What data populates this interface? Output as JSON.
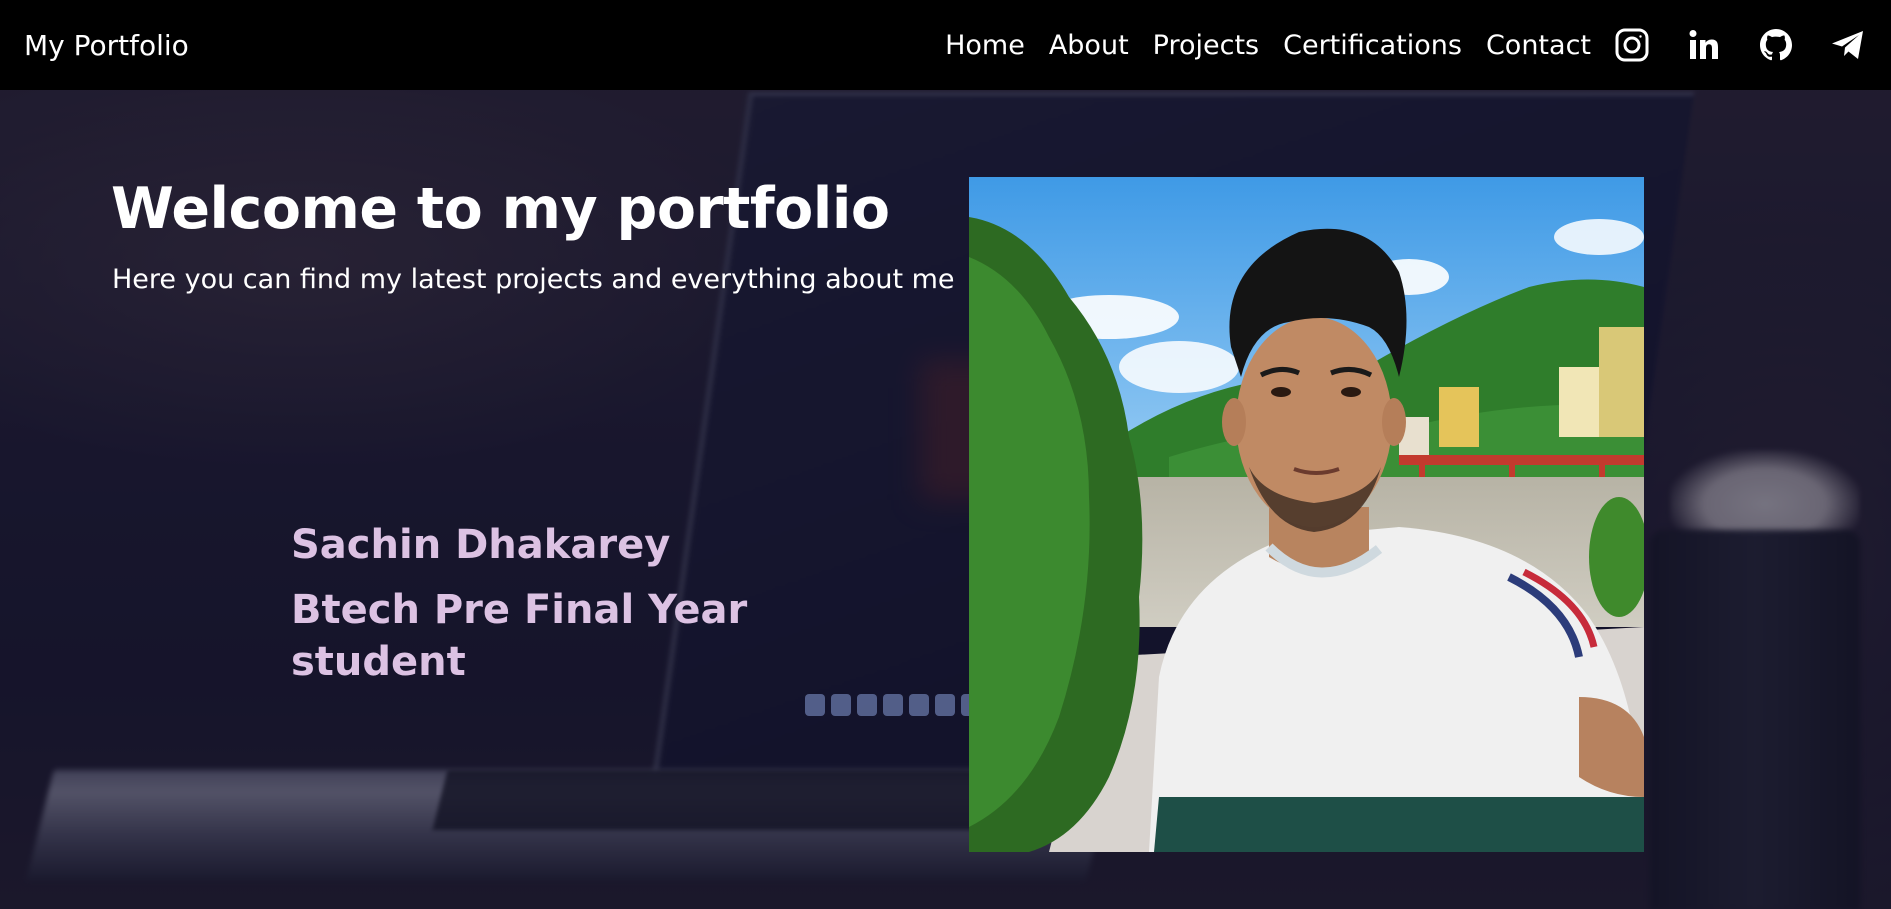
{
  "navbar": {
    "brand": "My Portfolio",
    "links": [
      {
        "label": "Home"
      },
      {
        "label": "About"
      },
      {
        "label": "Projects"
      },
      {
        "label": "Certifications"
      },
      {
        "label": "Contact"
      }
    ],
    "social": [
      {
        "icon": "instagram-icon"
      },
      {
        "icon": "linkedin-icon"
      },
      {
        "icon": "github-icon"
      },
      {
        "icon": "telegram-icon"
      }
    ]
  },
  "hero": {
    "title": "Welcome to my portfolio",
    "subtitle": "Here you can find my latest projects and everything about me",
    "name": "Sachin Dhakarey",
    "role": "Btech Pre Final Year student"
  },
  "colors": {
    "navbar_bg": "#000000",
    "text_primary": "#ffffff",
    "accent_lavender": "#dcc2e3",
    "overlay": "#0e0e28"
  }
}
